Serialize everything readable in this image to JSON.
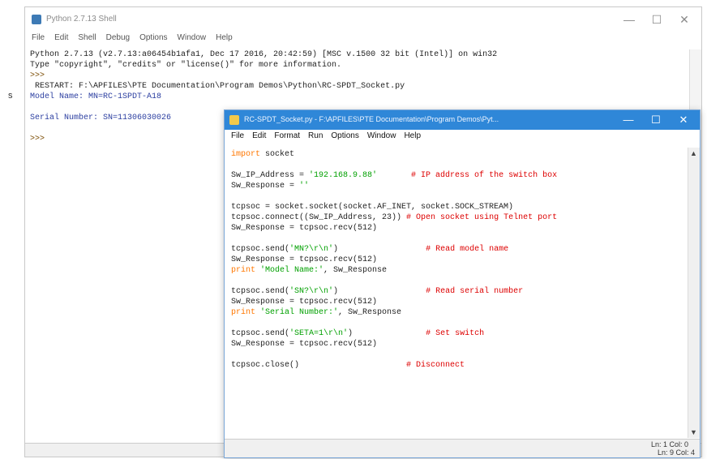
{
  "left_stub": {
    "text": "s"
  },
  "shell": {
    "title": "Python 2.7.13 Shell",
    "menu": [
      "File",
      "Edit",
      "Shell",
      "Debug",
      "Options",
      "Window",
      "Help"
    ],
    "lines": [
      {
        "text": "Python 2.7.13 (v2.7.13:a06454b1afa1, Dec 17 2016, 20:42:59) [MSC v.1500 32 bit (Intel)] on win32",
        "cls": "c-out"
      },
      {
        "text": "Type \"copyright\", \"credits\" or \"license()\" for more information.",
        "cls": "c-out"
      },
      {
        "text": ">>> ",
        "cls": "c-prompt"
      },
      {
        "text": " RESTART: F:\\APFILES\\PTE Documentation\\Program Demos\\Python\\RC-SPDT_Socket.py",
        "cls": "c-out"
      },
      {
        "text": "Model Name: MN=RC-1SPDT-A18",
        "cls": "c-blue"
      },
      {
        "text": "",
        "cls": "c-out"
      },
      {
        "text": "Serial Number: SN=11306030026",
        "cls": "c-blue"
      },
      {
        "text": "",
        "cls": "c-out"
      },
      {
        "text": ">>> ",
        "cls": "c-prompt"
      }
    ],
    "status": "Ln: 9  Col: 4",
    "controls": {
      "minimize": "—",
      "maximize": "☐",
      "close": "✕"
    }
  },
  "editor": {
    "title": "RC-SPDT_Socket.py - F:\\APFILES\\PTE Documentation\\Program Demos\\Pyt...",
    "menu": [
      "File",
      "Edit",
      "Format",
      "Run",
      "Options",
      "Window",
      "Help"
    ],
    "controls": {
      "minimize": "—",
      "maximize": "☐",
      "close": "✕"
    },
    "code": [
      [
        {
          "t": "import",
          "c": "kw"
        },
        {
          "t": " socket",
          "c": "df"
        }
      ],
      [],
      [
        {
          "t": "Sw_IP_Address = ",
          "c": "df"
        },
        {
          "t": "'192.168.9.88'",
          "c": "str"
        },
        {
          "t": "       ",
          "c": "df"
        },
        {
          "t": "# IP address of the switch box",
          "c": "cm"
        }
      ],
      [
        {
          "t": "Sw_Response = ",
          "c": "df"
        },
        {
          "t": "''",
          "c": "str"
        }
      ],
      [],
      [
        {
          "t": "tcpsoc = socket.socket(socket.AF_INET, socket.SOCK_STREAM)",
          "c": "df"
        }
      ],
      [
        {
          "t": "tcpsoc.connect((Sw_IP_Address, 23)) ",
          "c": "df"
        },
        {
          "t": "# Open socket using Telnet port",
          "c": "cm"
        }
      ],
      [
        {
          "t": "Sw_Response = tcpsoc.recv(512)",
          "c": "df"
        }
      ],
      [],
      [
        {
          "t": "tcpsoc.send(",
          "c": "df"
        },
        {
          "t": "'MN?\\r\\n'",
          "c": "str"
        },
        {
          "t": ")",
          "c": "df"
        },
        {
          "t": "                  ",
          "c": "df"
        },
        {
          "t": "# Read model name",
          "c": "cm"
        }
      ],
      [
        {
          "t": "Sw_Response = tcpsoc.recv(512)",
          "c": "df"
        }
      ],
      [
        {
          "t": "print",
          "c": "kw"
        },
        {
          "t": " ",
          "c": "df"
        },
        {
          "t": "'Model Name:'",
          "c": "str"
        },
        {
          "t": ", Sw_Response",
          "c": "df"
        }
      ],
      [],
      [
        {
          "t": "tcpsoc.send(",
          "c": "df"
        },
        {
          "t": "'SN?\\r\\n'",
          "c": "str"
        },
        {
          "t": ")",
          "c": "df"
        },
        {
          "t": "                  ",
          "c": "df"
        },
        {
          "t": "# Read serial number",
          "c": "cm"
        }
      ],
      [
        {
          "t": "Sw_Response = tcpsoc.recv(512)",
          "c": "df"
        }
      ],
      [
        {
          "t": "print",
          "c": "kw"
        },
        {
          "t": " ",
          "c": "df"
        },
        {
          "t": "'Serial Number:'",
          "c": "str"
        },
        {
          "t": ", Sw_Response",
          "c": "df"
        }
      ],
      [],
      [
        {
          "t": "tcpsoc.send(",
          "c": "df"
        },
        {
          "t": "'SETA=1\\r\\n'",
          "c": "str"
        },
        {
          "t": ")",
          "c": "df"
        },
        {
          "t": "               ",
          "c": "df"
        },
        {
          "t": "# Set switch",
          "c": "cm"
        }
      ],
      [
        {
          "t": "Sw_Response = tcpsoc.recv(512)",
          "c": "df"
        }
      ],
      [],
      [
        {
          "t": "tcpsoc.close()",
          "c": "df"
        },
        {
          "t": "                      ",
          "c": "df"
        },
        {
          "t": "# Disconnect",
          "c": "cm"
        }
      ]
    ],
    "status_editor": "Ln: 1  Col: 0",
    "status_shell": "Ln: 9  Col: 4"
  }
}
